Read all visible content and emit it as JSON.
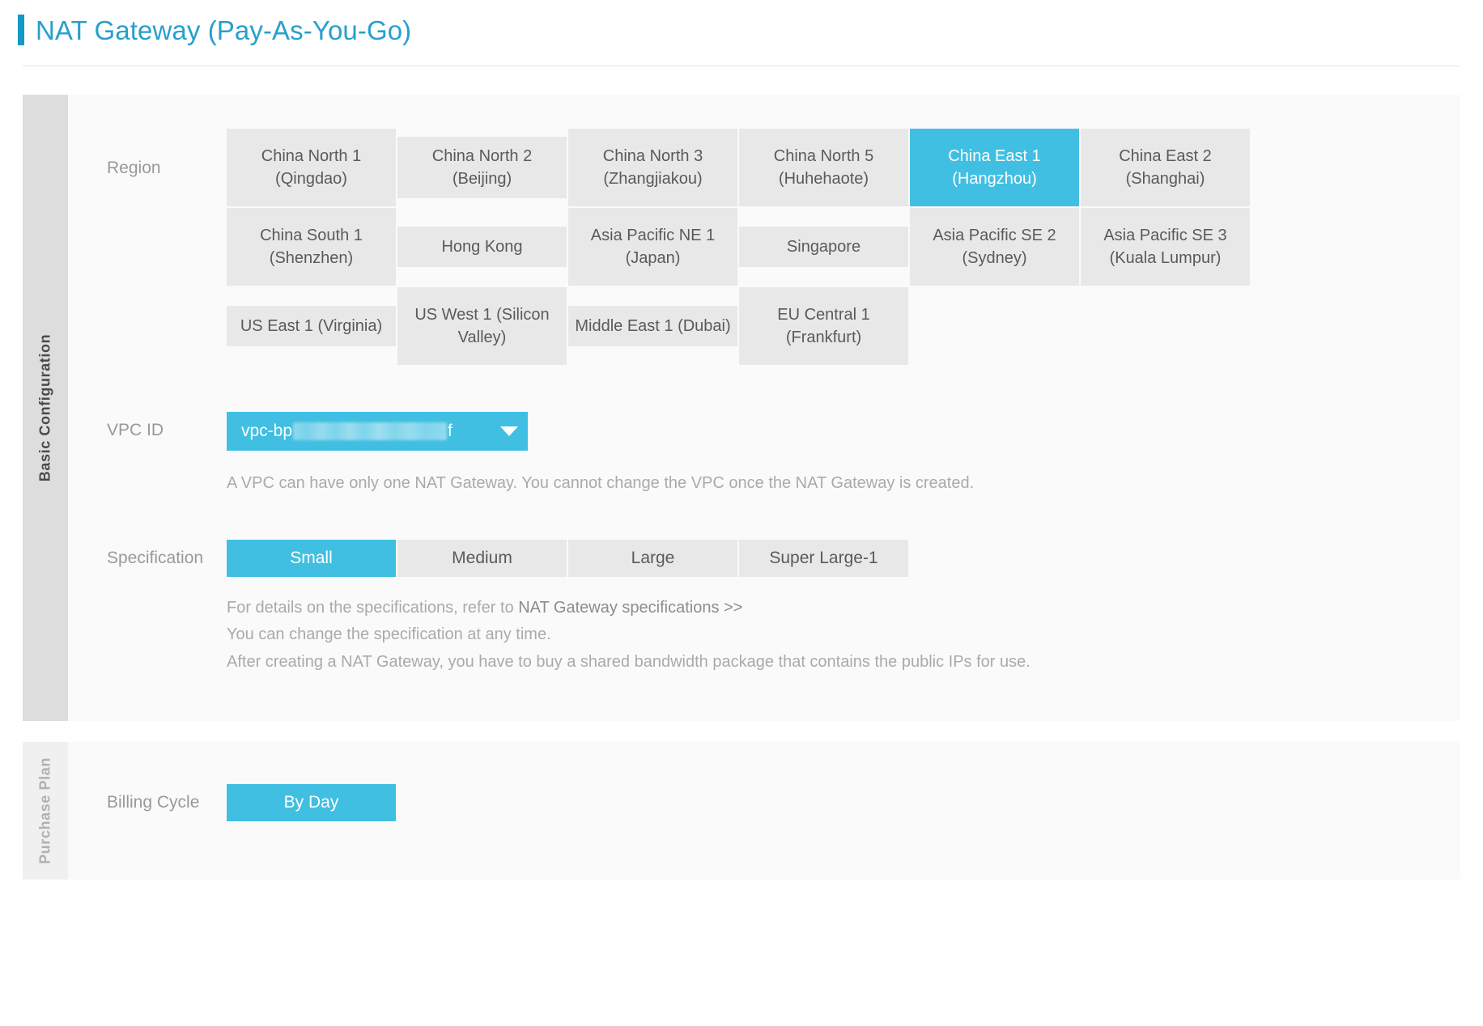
{
  "header": {
    "title": "NAT Gateway (Pay-As-You-Go)",
    "accent_color": "#27a0cc",
    "accent_bar_color": "#1599c6"
  },
  "theme": {
    "selected_color": "#40bfe2",
    "cell_color": "#e8e8e8",
    "panel_bg": "#fafafa",
    "tab_bg": "#dddddd"
  },
  "sections": [
    {
      "tab_label": "Basic Configuration",
      "active": true
    },
    {
      "tab_label": "Purchase Plan",
      "active": false
    }
  ],
  "region": {
    "label": "Region",
    "cells": [
      {
        "line1": "China North 1",
        "line2": "(Qingdao)",
        "selected": false,
        "lines": 2,
        "col": 1,
        "row": 1
      },
      {
        "line1": "China North 2 (Beijing)",
        "line2": "",
        "selected": false,
        "lines": 1,
        "col": 2,
        "row": 1
      },
      {
        "line1": "China North 3",
        "line2": "(Zhangjiakou)",
        "selected": false,
        "lines": 2,
        "col": 3,
        "row": 1
      },
      {
        "line1": "China North 5",
        "line2": "(Huhehaote)",
        "selected": false,
        "lines": 2,
        "col": 4,
        "row": 1
      },
      {
        "line1": "China East 1",
        "line2": "(Hangzhou)",
        "selected": true,
        "lines": 2,
        "col": 5,
        "row": 1
      },
      {
        "line1": "China East 2",
        "line2": "(Shanghai)",
        "selected": false,
        "lines": 2,
        "col": 6,
        "row": 1
      },
      {
        "line1": "China South 1",
        "line2": "(Shenzhen)",
        "selected": false,
        "lines": 2,
        "col": 1,
        "row": 2
      },
      {
        "line1": "Hong Kong",
        "line2": "",
        "selected": false,
        "lines": 1,
        "col": 2,
        "row": 2
      },
      {
        "line1": "Asia Pacific NE 1",
        "line2": "(Japan)",
        "selected": false,
        "lines": 2,
        "col": 3,
        "row": 2
      },
      {
        "line1": "Singapore",
        "line2": "",
        "selected": false,
        "lines": 1,
        "col": 4,
        "row": 2
      },
      {
        "line1": "Asia Pacific SE 2",
        "line2": "(Sydney)",
        "selected": false,
        "lines": 2,
        "col": 5,
        "row": 2
      },
      {
        "line1": "Asia Pacific SE 3",
        "line2": "(Kuala Lumpur)",
        "selected": false,
        "lines": 2,
        "col": 6,
        "row": 2
      },
      {
        "line1": "US East 1 (Virginia)",
        "line2": "",
        "selected": false,
        "lines": 1,
        "col": 1,
        "row": 3
      },
      {
        "line1": "US West 1 (Silicon",
        "line2": "Valley)",
        "selected": false,
        "lines": 2,
        "col": 2,
        "row": 3
      },
      {
        "line1": "Middle East 1 (Dubai)",
        "line2": "",
        "selected": false,
        "lines": 1,
        "col": 3,
        "row": 3
      },
      {
        "line1": "EU Central 1",
        "line2": "(Frankfurt)",
        "selected": false,
        "lines": 2,
        "col": 4,
        "row": 3
      }
    ]
  },
  "vpc": {
    "label": "VPC ID",
    "value_prefix": "vpc-bp",
    "value_suffix": "f",
    "redacted": true,
    "caret_icon": "chevron-down-icon",
    "helper": "A VPC can have only one NAT Gateway. You cannot change the VPC once the NAT Gateway is created."
  },
  "specification": {
    "label": "Specification",
    "options": [
      {
        "label": "Small",
        "selected": true
      },
      {
        "label": "Medium",
        "selected": false
      },
      {
        "label": "Large",
        "selected": false
      },
      {
        "label": "Super Large-1",
        "selected": false
      }
    ],
    "help_line1_prefix": "For details on the specifications, refer to ",
    "help_line1_link": "NAT Gateway specifications >>",
    "help_line2": "You can change the specification at any time.",
    "help_line3": "After creating a NAT Gateway, you have to buy a shared bandwidth package that contains the public IPs for use."
  },
  "billing": {
    "label": "Billing Cycle",
    "options": [
      {
        "label": "By Day",
        "selected": true
      }
    ]
  }
}
